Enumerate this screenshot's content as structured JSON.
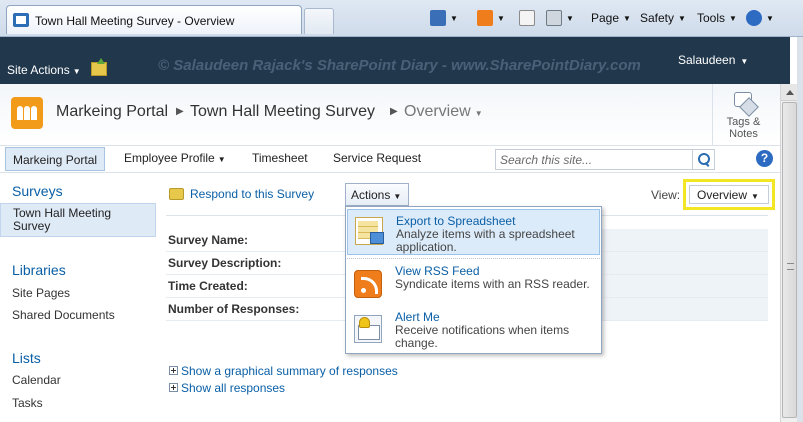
{
  "browser": {
    "tab_title": "Town Hall Meeting Survey - Overview",
    "commands": {
      "page": "Page",
      "safety": "Safety",
      "tools": "Tools"
    }
  },
  "header": {
    "site_actions": "Site Actions",
    "watermark": "© Salaudeen Rajack's SharePoint Diary - www.SharePointDiary.com",
    "user": "Salaudeen"
  },
  "breadcrumb": {
    "site": "Markeing Portal",
    "list": "Town Hall Meeting Survey",
    "page": "Overview"
  },
  "tags_notes": {
    "line1": "Tags &",
    "line2": "Notes"
  },
  "top_nav": {
    "home": "Markeing Portal",
    "items": [
      "Employee Profile",
      "Timesheet",
      "Service Request"
    ],
    "search_placeholder": "Search this site..."
  },
  "left_nav": {
    "surveys_heading": "Surveys",
    "surveys_item": "Town Hall Meeting Survey",
    "libraries_heading": "Libraries",
    "libraries_items": [
      "Site Pages",
      "Shared Documents"
    ],
    "lists_heading": "Lists",
    "lists_items": [
      "Calendar",
      "Tasks"
    ]
  },
  "toolbar": {
    "respond": "Respond to this Survey",
    "actions": "Actions",
    "view_label": "View:",
    "view_value": "Overview"
  },
  "details": {
    "rows": [
      "Survey Name:",
      "Survey Description:",
      "Time Created:",
      "Number of Responses:"
    ]
  },
  "links": {
    "graphical": "Show a graphical summary of responses",
    "all": "Show all responses"
  },
  "actions_menu": {
    "items": [
      {
        "title": "Export to Spreadsheet",
        "desc": "Analyze items with a spreadsheet application.",
        "icon": "spreadsheet-icon"
      },
      {
        "title": "View RSS Feed",
        "desc": "Syndicate items with an RSS reader.",
        "icon": "rss-icon"
      },
      {
        "title": "Alert Me",
        "desc": "Receive notifications when items change.",
        "icon": "alert-icon"
      }
    ]
  },
  "colors": {
    "sp_header": "#21374c",
    "link": "#0a5fa6",
    "view_highlight": "#f2e625",
    "menu_highlight": "#dcebfa"
  }
}
